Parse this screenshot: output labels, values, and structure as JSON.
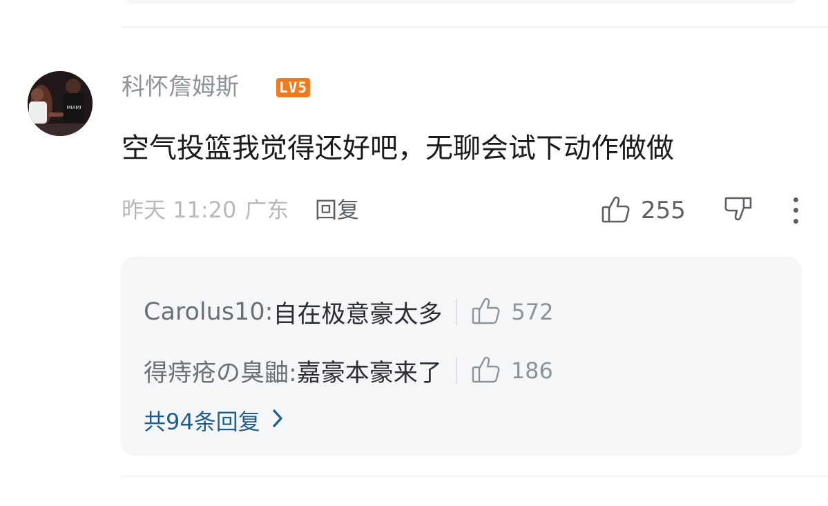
{
  "comment": {
    "username": "科怀詹姆斯",
    "level_badge": "LV5",
    "text": "空气投篮我觉得还好吧，无聊会试下动作做做",
    "time": "昨天 11:20",
    "location": "广东",
    "reply_label": "回复",
    "like_count": "255",
    "icons": {
      "like": "thumbs-up-icon",
      "dislike": "thumbs-down-icon",
      "more": "more-vertical-icon"
    }
  },
  "replies": [
    {
      "author": "Carolus10: ",
      "text": "自在极意豪太多",
      "like_count": "572"
    },
    {
      "author": "得痔疮の臭鼬: ",
      "text": "嘉豪本豪来了",
      "like_count": "186"
    }
  ],
  "total_replies_label": "共94条回复",
  "colors": {
    "badge": "#f07b1e",
    "link": "#1d5e8c",
    "card_bg": "#f5f6f8"
  }
}
